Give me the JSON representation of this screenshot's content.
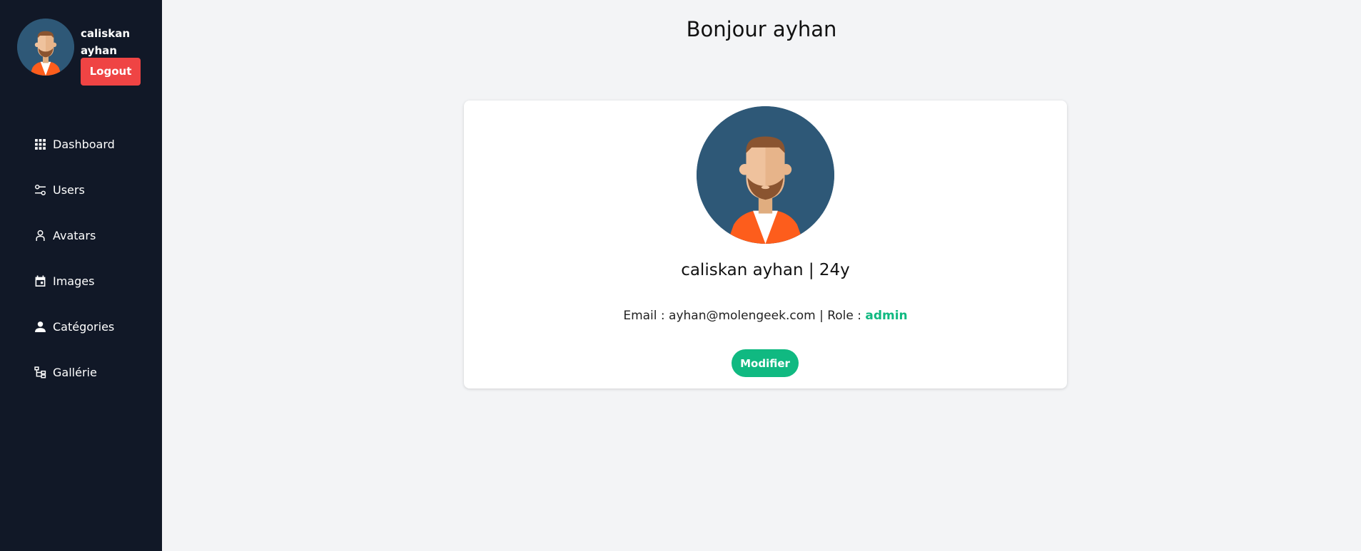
{
  "sidebar": {
    "profile": {
      "name": "caliskan ayhan",
      "logout_label": "Logout"
    },
    "items": [
      {
        "label": "Dashboard",
        "icon": "grid-icon"
      },
      {
        "label": "Users",
        "icon": "sliders-icon"
      },
      {
        "label": "Avatars",
        "icon": "user-outline-icon"
      },
      {
        "label": "Images",
        "icon": "calendar-icon"
      },
      {
        "label": "Catégories",
        "icon": "user-icon"
      },
      {
        "label": "Gallérie",
        "icon": "hierarchy-icon"
      }
    ]
  },
  "main": {
    "greeting": "Bonjour ayhan",
    "card": {
      "user_line": "caliskan ayhan | 24y",
      "email_prefix": "Email : ",
      "email": "ayhan@molengeek.com",
      "role_prefix": " | Role : ",
      "role": "admin",
      "modify_label": "Modifier"
    }
  },
  "colors": {
    "sidebar_bg": "#111827",
    "logout": "#ef4444",
    "accent": "#10b981",
    "avatar_bg": "#2e5877"
  }
}
